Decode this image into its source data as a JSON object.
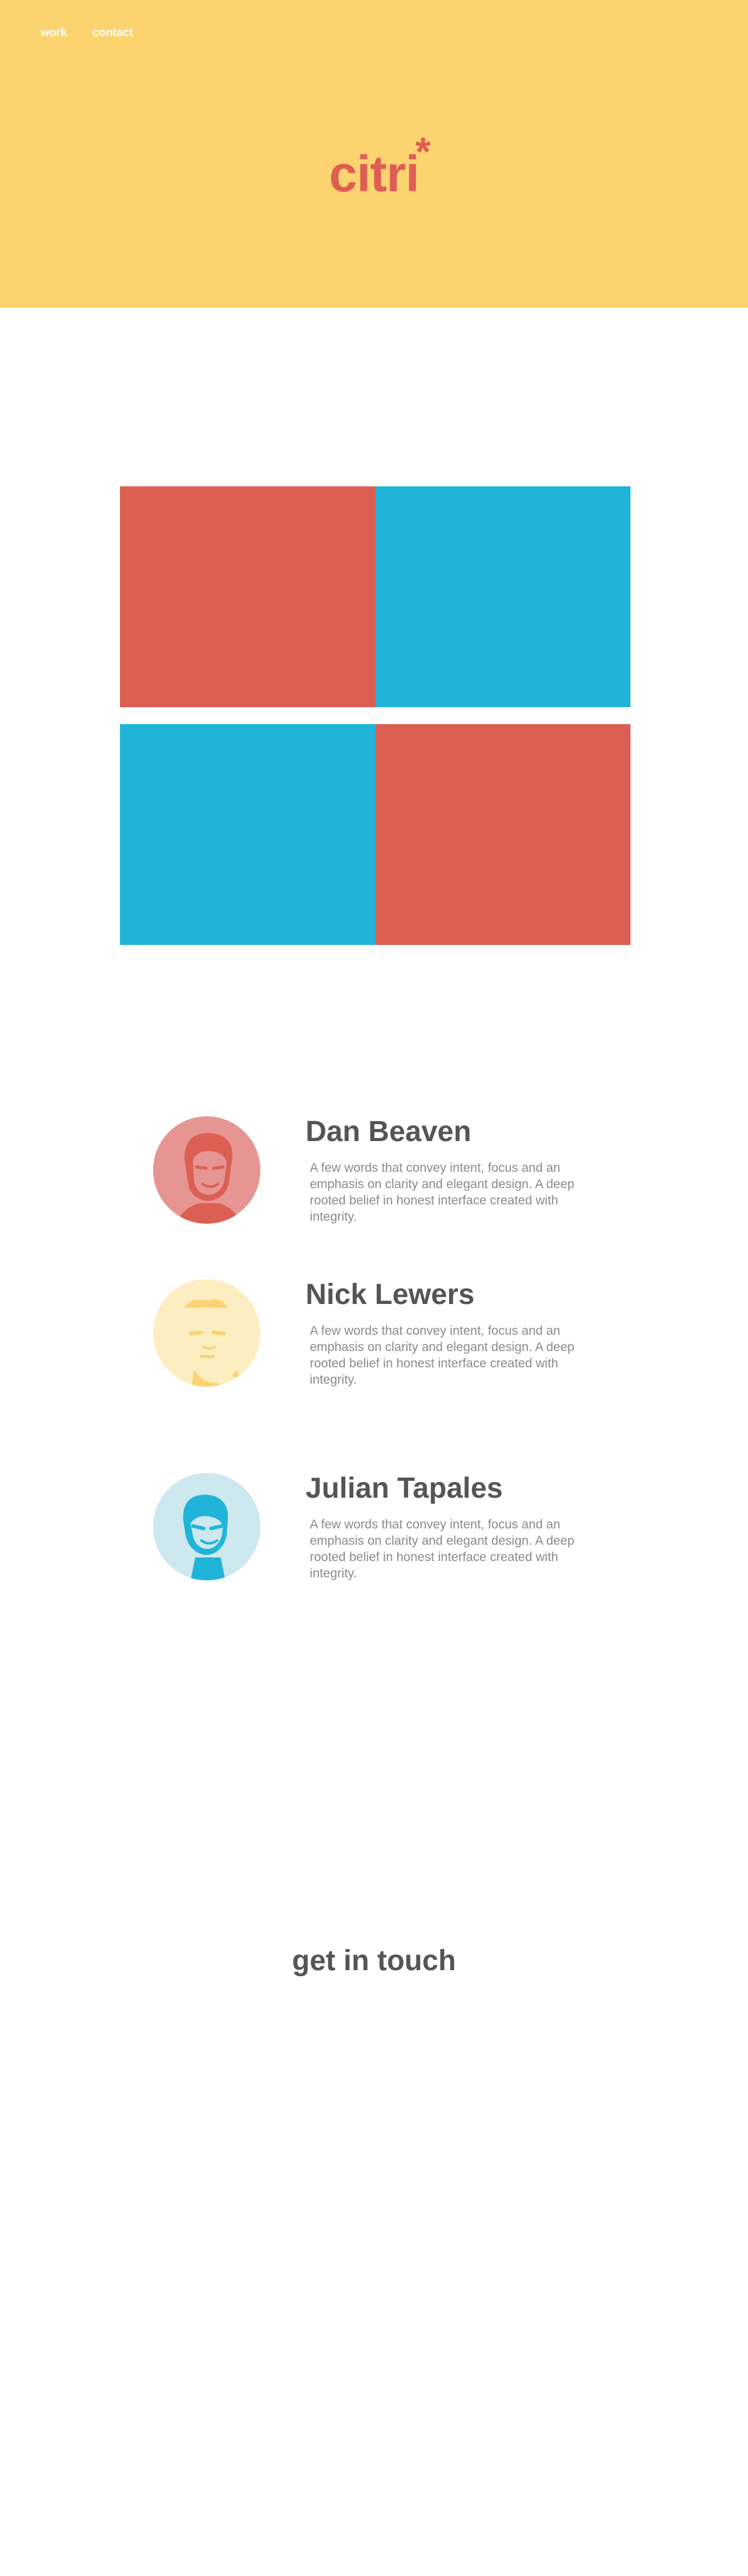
{
  "nav": {
    "work_label": "work",
    "contact_label": "contact"
  },
  "brand": {
    "name": "citri",
    "mark": "*",
    "color": "#df5e54",
    "hero_bg": "#fbd36f"
  },
  "grid": {
    "colors": {
      "red": "#dc5f54",
      "blue": "#20b4d9"
    },
    "tiles": [
      "red",
      "blue",
      "blue",
      "red"
    ]
  },
  "team": [
    {
      "name": "Dan Beaven",
      "bio": "A few words that convey intent, focus and an emphasis on clarity and elegant design. A deep rooted belief in honest interface created with integrity.",
      "avatar_bg": "#e69592",
      "avatar_fg": "#dc5f54"
    },
    {
      "name": "Nick Lewers",
      "bio": "A few words that convey intent, focus and an emphasis on clarity and elegant design. A deep rooted belief in honest interface created with integrity.",
      "avatar_bg": "#fdeec2",
      "avatar_fg": "#fbd36f"
    },
    {
      "name": "Julian Tapales",
      "bio": "A few words that convey intent, focus and an emphasis on clarity and elegant design. A deep rooted belief in honest interface created with integrity.",
      "avatar_bg": "#cde8ee",
      "avatar_fg": "#20b4d9"
    }
  ],
  "contact": {
    "title": "get in touch"
  }
}
